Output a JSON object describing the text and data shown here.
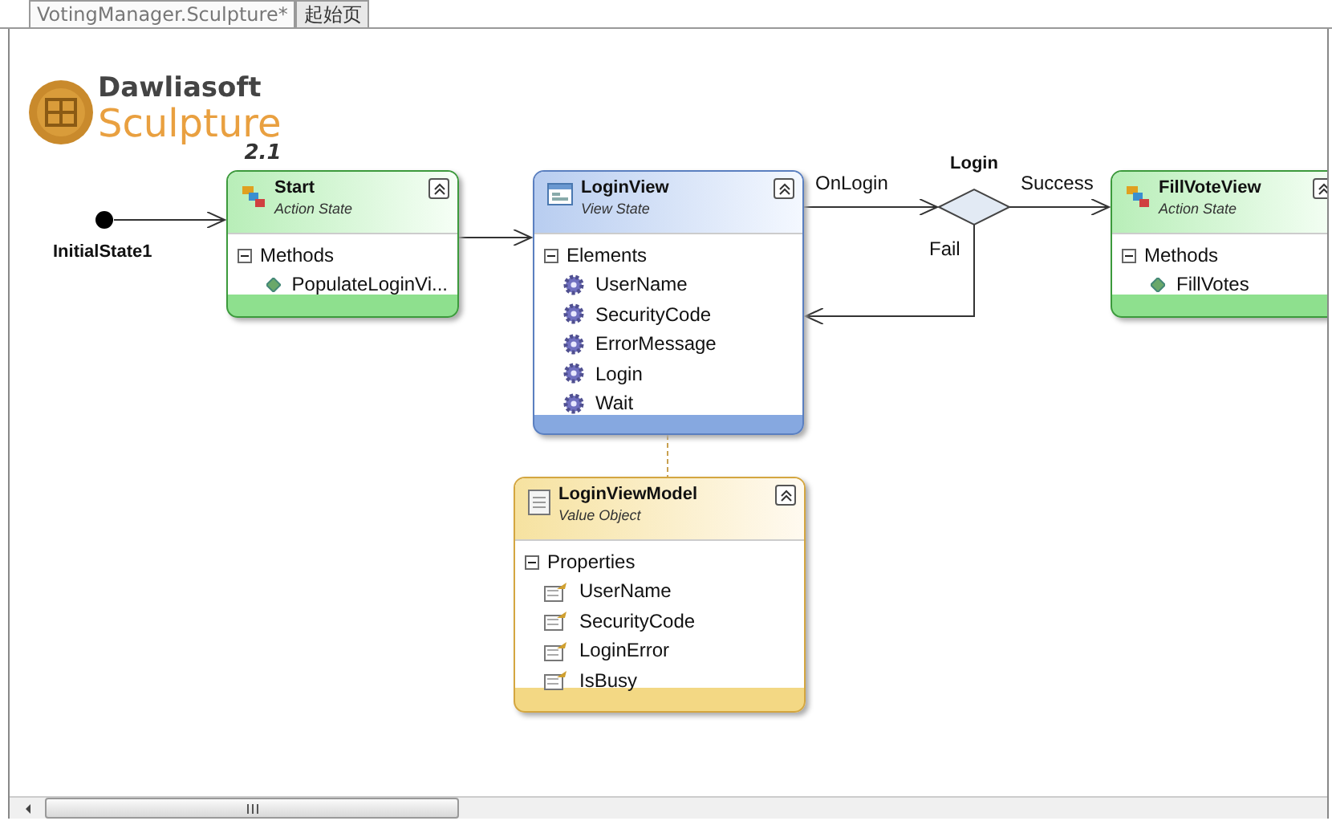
{
  "tabs": [
    {
      "label": "VotingManager.Sculpture*",
      "selected": true
    },
    {
      "label": "起始页",
      "selected": false
    }
  ],
  "logo": {
    "line1": "Dawliasoft",
    "line2": "Sculpture",
    "version": "2.1"
  },
  "initial_state": {
    "label": "InitialState1"
  },
  "decision": {
    "label": "Login"
  },
  "transitions": [
    {
      "label": "OnLogin"
    },
    {
      "label": "Success"
    },
    {
      "label": "Fail"
    }
  ],
  "nodes": [
    {
      "kind": "action_state",
      "title": "Start",
      "subtitle": "Action State",
      "section": {
        "label": "Methods",
        "expanded": true,
        "items": [
          "PopulateLoginVi..."
        ]
      }
    },
    {
      "kind": "view_state",
      "title": "LoginView",
      "subtitle": "View State",
      "section": {
        "label": "Elements",
        "expanded": true,
        "items": [
          "UserName",
          "SecurityCode",
          "ErrorMessage",
          "Login",
          "Wait"
        ]
      }
    },
    {
      "kind": "action_state",
      "title": "FillVoteView",
      "subtitle": "Action State",
      "section": {
        "label": "Methods",
        "expanded": true,
        "items": [
          "FillVotes"
        ]
      }
    },
    {
      "kind": "value_object",
      "title": "LoginViewModel",
      "subtitle": "Value Object",
      "section": {
        "label": "Properties",
        "expanded": true,
        "items": [
          "UserName",
          "SecurityCode",
          "LoginError",
          "IsBusy"
        ]
      }
    }
  ]
}
